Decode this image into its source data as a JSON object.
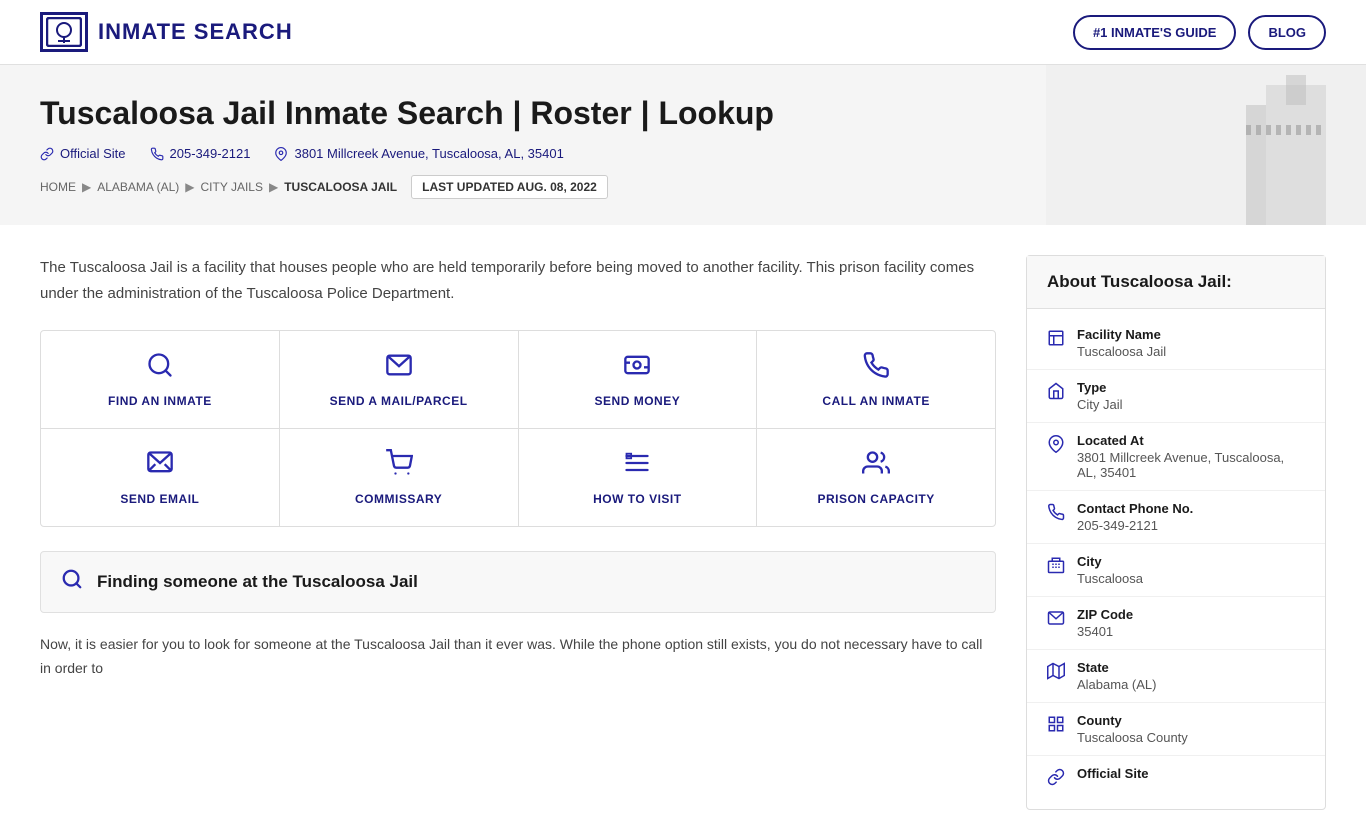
{
  "header": {
    "logo_text": "INMATE SEARCH",
    "nav_buttons": [
      {
        "id": "inmates-guide",
        "label": "#1 INMATE'S GUIDE"
      },
      {
        "id": "blog",
        "label": "BLOG"
      }
    ]
  },
  "hero": {
    "title": "Tuscaloosa Jail Inmate Search | Roster | Lookup",
    "official_site_label": "Official Site",
    "phone": "205-349-2121",
    "address": "3801 Millcreek Avenue, Tuscaloosa, AL, 35401",
    "breadcrumb": [
      {
        "label": "HOME",
        "href": "#"
      },
      {
        "label": "ALABAMA (AL)",
        "href": "#"
      },
      {
        "label": "CITY JAILS",
        "href": "#"
      },
      {
        "label": "TUSCALOOSA JAIL",
        "href": "#"
      }
    ],
    "last_updated": "LAST UPDATED AUG. 08, 2022"
  },
  "description": "The Tuscaloosa Jail is a facility that houses people who are held temporarily before being moved to another facility. This prison facility comes under the administration of the Tuscaloosa Police Department.",
  "action_grid": {
    "rows": [
      [
        {
          "id": "find-inmate",
          "icon": "search",
          "label": "FIND AN INMATE"
        },
        {
          "id": "send-mail",
          "icon": "mail",
          "label": "SEND A MAIL/PARCEL"
        },
        {
          "id": "send-money",
          "icon": "money",
          "label": "SEND MONEY"
        },
        {
          "id": "call-inmate",
          "icon": "phone",
          "label": "CALL AN INMATE"
        }
      ],
      [
        {
          "id": "send-email",
          "icon": "email",
          "label": "SEND EMAIL"
        },
        {
          "id": "commissary",
          "icon": "cart",
          "label": "COMMISSARY"
        },
        {
          "id": "how-to-visit",
          "icon": "visit",
          "label": "HOW TO VISIT"
        },
        {
          "id": "prison-capacity",
          "icon": "people",
          "label": "PRISON CAPACITY"
        }
      ]
    ]
  },
  "find_section": {
    "icon": "search",
    "title": "Finding someone at the Tuscaloosa Jail"
  },
  "para_content": "Now, it is easier for you to look for someone at the Tuscaloosa Jail than it ever was. While the phone option still exists, you do not necessary have to call in order to",
  "sidebar": {
    "title": "About Tuscaloosa Jail:",
    "rows": [
      {
        "id": "facility-name",
        "icon": "building",
        "label": "Facility Name",
        "value": "Tuscaloosa Jail"
      },
      {
        "id": "type",
        "icon": "type",
        "label": "Type",
        "value": "City Jail"
      },
      {
        "id": "located-at",
        "icon": "location",
        "label": "Located At",
        "value": "3801 Millcreek Avenue, Tuscaloosa, AL, 35401"
      },
      {
        "id": "contact-phone",
        "icon": "phone",
        "label": "Contact Phone No.",
        "value": "205-349-2121"
      },
      {
        "id": "city",
        "icon": "city",
        "label": "City",
        "value": "Tuscaloosa"
      },
      {
        "id": "zip-code",
        "icon": "mail",
        "label": "ZIP Code",
        "value": "35401"
      },
      {
        "id": "state",
        "icon": "map",
        "label": "State",
        "value": "Alabama (AL)"
      },
      {
        "id": "county",
        "icon": "county",
        "label": "County",
        "value": "Tuscaloosa County"
      },
      {
        "id": "official-site",
        "icon": "link",
        "label": "Official Site",
        "value": ""
      }
    ]
  }
}
